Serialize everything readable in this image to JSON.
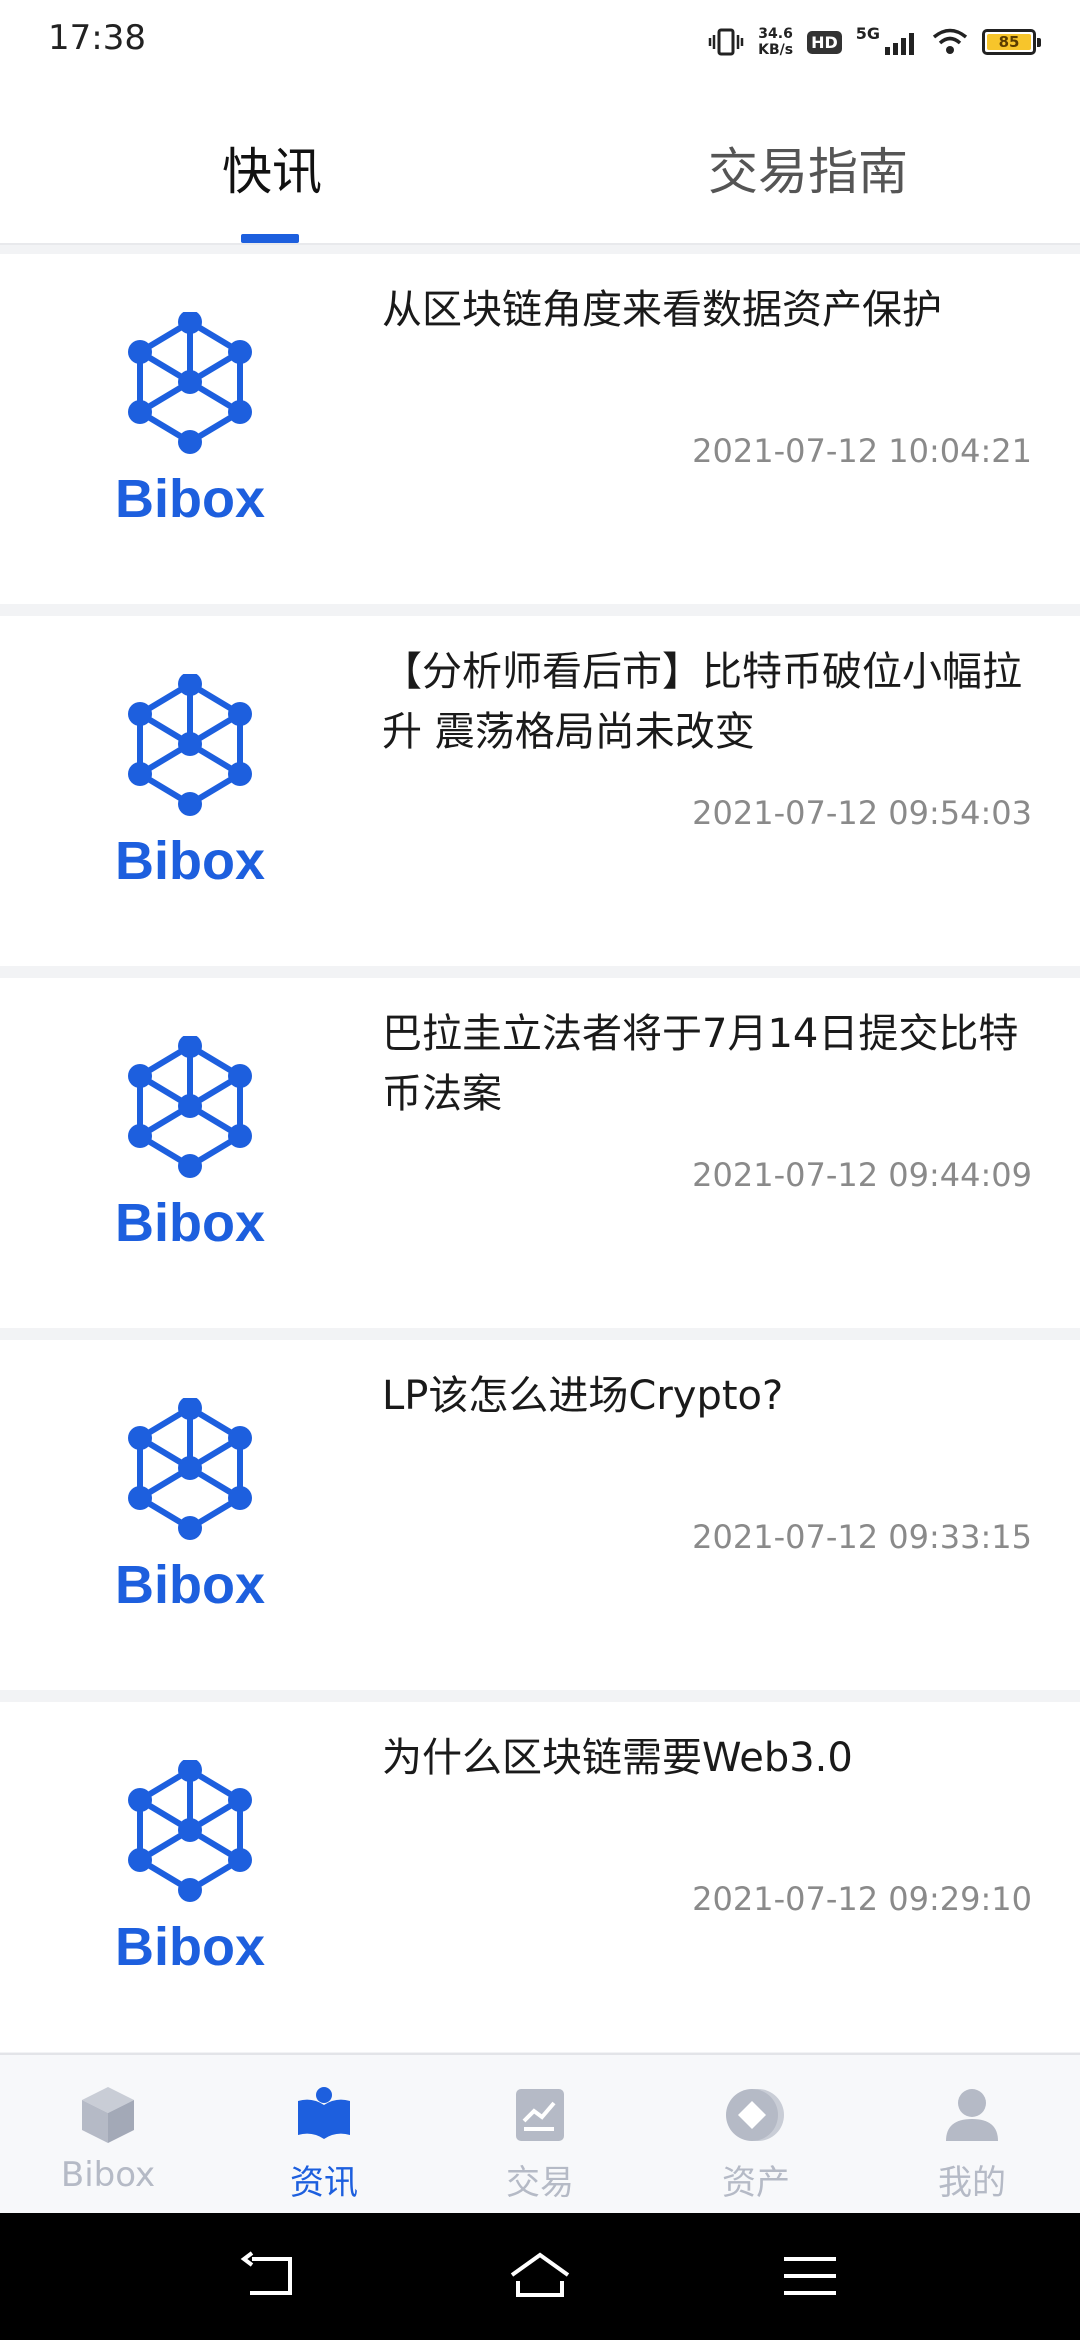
{
  "status": {
    "time": "17:38",
    "speed": "34.6",
    "speed_unit": "KB/s",
    "hd": "HD",
    "network": "5G",
    "battery": "85"
  },
  "tabs": [
    {
      "label": "快讯"
    },
    {
      "label": "交易指南"
    }
  ],
  "news": [
    {
      "logo_text": "Bibox",
      "title": "从区块链角度来看数据资产保护",
      "time": "2021-07-12 10:04:21"
    },
    {
      "logo_text": "Bibox",
      "title": "【分析师看后市】比特币破位小幅拉升 震荡格局尚未改变",
      "time": "2021-07-12 09:54:03"
    },
    {
      "logo_text": "Bibox",
      "title": "巴拉圭立法者将于7月14日提交比特币法案",
      "time": "2021-07-12 09:44:09"
    },
    {
      "logo_text": "Bibox",
      "title": "LP该怎么进场Crypto?",
      "time": "2021-07-12 09:33:15"
    },
    {
      "logo_text": "Bibox",
      "title": "为什么区块链需要Web3.0",
      "time": "2021-07-12 09:29:10"
    }
  ],
  "bottom_nav": [
    {
      "label": "Bibox",
      "icon": "cube-icon"
    },
    {
      "label": "资讯",
      "icon": "book-icon",
      "active": true
    },
    {
      "label": "交易",
      "icon": "chart-icon"
    },
    {
      "label": "资产",
      "icon": "coin-icon"
    },
    {
      "label": "我的",
      "icon": "person-icon"
    }
  ],
  "colors": {
    "accent": "#1d5fde",
    "inactive": "#b5bac6",
    "timestamp": "#8a8a8a"
  }
}
